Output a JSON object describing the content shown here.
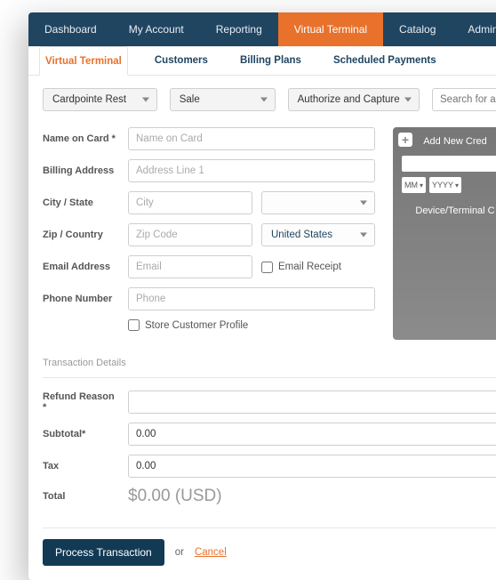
{
  "topnav": {
    "items": [
      {
        "label": "Dashboard"
      },
      {
        "label": "My Account"
      },
      {
        "label": "Reporting"
      },
      {
        "label": "Virtual Terminal",
        "active": true
      },
      {
        "label": "Catalog"
      },
      {
        "label": "Administration"
      }
    ]
  },
  "subtabs": {
    "items": [
      {
        "label": "Virtual Terminal",
        "active": true
      },
      {
        "label": "Customers"
      },
      {
        "label": "Billing Plans"
      },
      {
        "label": "Scheduled Payments"
      }
    ]
  },
  "actions": {
    "merchant": "Cardpointe Rest",
    "txn_type": "Sale",
    "capture_mode": "Authorize and Capture",
    "search_placeholder": "Search for a cu"
  },
  "form": {
    "name_label": "Name on Card *",
    "name_placeholder": "Name on Card",
    "billing_label": "Billing Address",
    "billing_placeholder": "Address Line 1",
    "citystate_label": "City / State",
    "city_placeholder": "City",
    "state_value": "",
    "zipcountry_label": "Zip / Country",
    "zip_placeholder": "Zip Code",
    "country_value": "United States",
    "email_label": "Email Address",
    "email_placeholder": "Email",
    "email_receipt_label": "Email Receipt",
    "phone_label": "Phone Number",
    "phone_placeholder": "Phone",
    "store_profile_label": "Store Customer Profile"
  },
  "card_widget": {
    "title": "Add New Cred",
    "mm": "MM",
    "yyyy": "YYYY",
    "device_label": "Device/Terminal C"
  },
  "txn": {
    "section_title": "Transaction Details",
    "refund_label": "Refund Reason *",
    "refund_value": "",
    "subtotal_label": "Subtotal*",
    "subtotal_value": "0.00",
    "tax_label": "Tax",
    "tax_value": "0.00",
    "total_label": "Total",
    "total_value": "$0.00 (USD)"
  },
  "footer": {
    "process_label": "Process Transaction",
    "or_label": "or",
    "cancel_label": "Cancel"
  }
}
